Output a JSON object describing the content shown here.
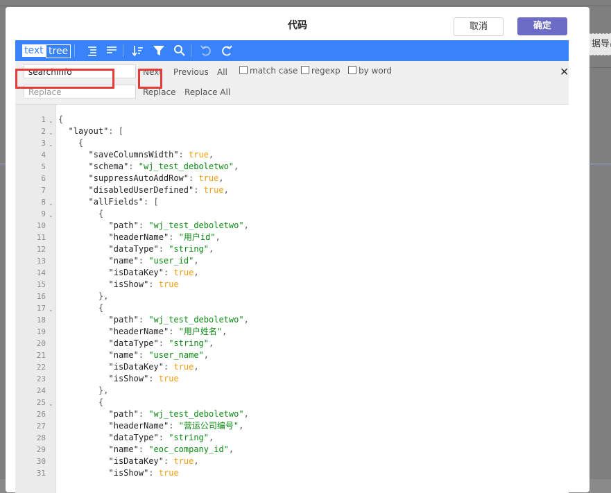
{
  "background": {
    "right_button_label": "据导出"
  },
  "modal": {
    "title": "代码",
    "cancel_label": "取消",
    "ok_label": "确定"
  },
  "menubar": {
    "mode_text": "text",
    "mode_tree": "tree",
    "icons": [
      "format-icon",
      "compact-icon",
      "sort-icon",
      "filter-icon",
      "search-icon",
      "undo-icon",
      "redo-icon"
    ],
    "accent": "#3883fa"
  },
  "search": {
    "find_value": "searchInfo",
    "replace_placeholder": "Replace",
    "next_label": "Next",
    "previous_label": "Previous",
    "all_label": "All",
    "match_case_label": "match case",
    "regexp_label": "regexp",
    "by_word_label": "by word",
    "replace_label": "Replace",
    "replace_all_label": "Replace All",
    "highlight_color": "#e93a3a"
  },
  "editor": {
    "lines": [
      {
        "n": "1",
        "fold": true,
        "indent": 0,
        "tokens": [
          [
            "p",
            "{"
          ]
        ]
      },
      {
        "n": "2",
        "fold": true,
        "indent": 1,
        "tokens": [
          [
            "k",
            "\"layout\""
          ],
          [
            "p",
            ": ["
          ]
        ]
      },
      {
        "n": "3",
        "fold": true,
        "indent": 2,
        "tokens": [
          [
            "p",
            "{"
          ]
        ]
      },
      {
        "n": "4",
        "fold": false,
        "indent": 3,
        "tokens": [
          [
            "k",
            "\"saveColumnsWidth\""
          ],
          [
            "p",
            ": "
          ],
          [
            "b",
            "true"
          ],
          [
            "p",
            ","
          ]
        ]
      },
      {
        "n": "5",
        "fold": false,
        "indent": 3,
        "tokens": [
          [
            "k",
            "\"schema\""
          ],
          [
            "p",
            ": "
          ],
          [
            "s",
            "\"wj_test_deboletwo\""
          ],
          [
            "p",
            ","
          ]
        ]
      },
      {
        "n": "6",
        "fold": false,
        "indent": 3,
        "tokens": [
          [
            "k",
            "\"suppressAutoAddRow\""
          ],
          [
            "p",
            ": "
          ],
          [
            "b",
            "true"
          ],
          [
            "p",
            ","
          ]
        ]
      },
      {
        "n": "7",
        "fold": false,
        "indent": 3,
        "tokens": [
          [
            "k",
            "\"disabledUserDefined\""
          ],
          [
            "p",
            ": "
          ],
          [
            "b",
            "true"
          ],
          [
            "p",
            ","
          ]
        ]
      },
      {
        "n": "8",
        "fold": true,
        "indent": 3,
        "tokens": [
          [
            "k",
            "\"allFields\""
          ],
          [
            "p",
            ": ["
          ]
        ]
      },
      {
        "n": "9",
        "fold": true,
        "indent": 4,
        "tokens": [
          [
            "p",
            "{"
          ]
        ]
      },
      {
        "n": "10",
        "fold": false,
        "indent": 5,
        "tokens": [
          [
            "k",
            "\"path\""
          ],
          [
            "p",
            ": "
          ],
          [
            "s",
            "\"wj_test_deboletwo\""
          ],
          [
            "p",
            ","
          ]
        ]
      },
      {
        "n": "11",
        "fold": false,
        "indent": 5,
        "tokens": [
          [
            "k",
            "\"headerName\""
          ],
          [
            "p",
            ": "
          ],
          [
            "s",
            "\"用户id\""
          ],
          [
            "p",
            ","
          ]
        ]
      },
      {
        "n": "12",
        "fold": false,
        "indent": 5,
        "tokens": [
          [
            "k",
            "\"dataType\""
          ],
          [
            "p",
            ": "
          ],
          [
            "s",
            "\"string\""
          ],
          [
            "p",
            ","
          ]
        ]
      },
      {
        "n": "13",
        "fold": false,
        "indent": 5,
        "tokens": [
          [
            "k",
            "\"name\""
          ],
          [
            "p",
            ": "
          ],
          [
            "s",
            "\"user_id\""
          ],
          [
            "p",
            ","
          ]
        ]
      },
      {
        "n": "14",
        "fold": false,
        "indent": 5,
        "tokens": [
          [
            "k",
            "\"isDataKey\""
          ],
          [
            "p",
            ": "
          ],
          [
            "b",
            "true"
          ],
          [
            "p",
            ","
          ]
        ]
      },
      {
        "n": "15",
        "fold": false,
        "indent": 5,
        "tokens": [
          [
            "k",
            "\"isShow\""
          ],
          [
            "p",
            ": "
          ],
          [
            "b",
            "true"
          ]
        ]
      },
      {
        "n": "16",
        "fold": false,
        "indent": 4,
        "tokens": [
          [
            "p",
            "},"
          ]
        ]
      },
      {
        "n": "17",
        "fold": true,
        "indent": 4,
        "tokens": [
          [
            "p",
            "{"
          ]
        ]
      },
      {
        "n": "18",
        "fold": false,
        "indent": 5,
        "tokens": [
          [
            "k",
            "\"path\""
          ],
          [
            "p",
            ": "
          ],
          [
            "s",
            "\"wj_test_deboletwo\""
          ],
          [
            "p",
            ","
          ]
        ]
      },
      {
        "n": "19",
        "fold": false,
        "indent": 5,
        "tokens": [
          [
            "k",
            "\"headerName\""
          ],
          [
            "p",
            ": "
          ],
          [
            "s",
            "\"用户姓名\""
          ],
          [
            "p",
            ","
          ]
        ]
      },
      {
        "n": "20",
        "fold": false,
        "indent": 5,
        "tokens": [
          [
            "k",
            "\"dataType\""
          ],
          [
            "p",
            ": "
          ],
          [
            "s",
            "\"string\""
          ],
          [
            "p",
            ","
          ]
        ]
      },
      {
        "n": "21",
        "fold": false,
        "indent": 5,
        "tokens": [
          [
            "k",
            "\"name\""
          ],
          [
            "p",
            ": "
          ],
          [
            "s",
            "\"user_name\""
          ],
          [
            "p",
            ","
          ]
        ]
      },
      {
        "n": "22",
        "fold": false,
        "indent": 5,
        "tokens": [
          [
            "k",
            "\"isDataKey\""
          ],
          [
            "p",
            ": "
          ],
          [
            "b",
            "true"
          ],
          [
            "p",
            ","
          ]
        ]
      },
      {
        "n": "23",
        "fold": false,
        "indent": 5,
        "tokens": [
          [
            "k",
            "\"isShow\""
          ],
          [
            "p",
            ": "
          ],
          [
            "b",
            "true"
          ]
        ]
      },
      {
        "n": "24",
        "fold": false,
        "indent": 4,
        "tokens": [
          [
            "p",
            "},"
          ]
        ]
      },
      {
        "n": "25",
        "fold": true,
        "indent": 4,
        "tokens": [
          [
            "p",
            "{"
          ]
        ]
      },
      {
        "n": "26",
        "fold": false,
        "indent": 5,
        "tokens": [
          [
            "k",
            "\"path\""
          ],
          [
            "p",
            ": "
          ],
          [
            "s",
            "\"wj_test_deboletwo\""
          ],
          [
            "p",
            ","
          ]
        ]
      },
      {
        "n": "27",
        "fold": false,
        "indent": 5,
        "tokens": [
          [
            "k",
            "\"headerName\""
          ],
          [
            "p",
            ": "
          ],
          [
            "s",
            "\"营运公司编号\""
          ],
          [
            "p",
            ","
          ]
        ]
      },
      {
        "n": "28",
        "fold": false,
        "indent": 5,
        "tokens": [
          [
            "k",
            "\"dataType\""
          ],
          [
            "p",
            ": "
          ],
          [
            "s",
            "\"string\""
          ],
          [
            "p",
            ","
          ]
        ]
      },
      {
        "n": "29",
        "fold": false,
        "indent": 5,
        "tokens": [
          [
            "k",
            "\"name\""
          ],
          [
            "p",
            ": "
          ],
          [
            "s",
            "\"eoc_company_id\""
          ],
          [
            "p",
            ","
          ]
        ]
      },
      {
        "n": "30",
        "fold": false,
        "indent": 5,
        "tokens": [
          [
            "k",
            "\"isDataKey\""
          ],
          [
            "p",
            ": "
          ],
          [
            "b",
            "true"
          ],
          [
            "p",
            ","
          ]
        ]
      },
      {
        "n": "31",
        "fold": false,
        "indent": 5,
        "tokens": [
          [
            "k",
            "\"isShow\""
          ],
          [
            "p",
            ": "
          ],
          [
            "b",
            "true"
          ]
        ]
      }
    ]
  }
}
